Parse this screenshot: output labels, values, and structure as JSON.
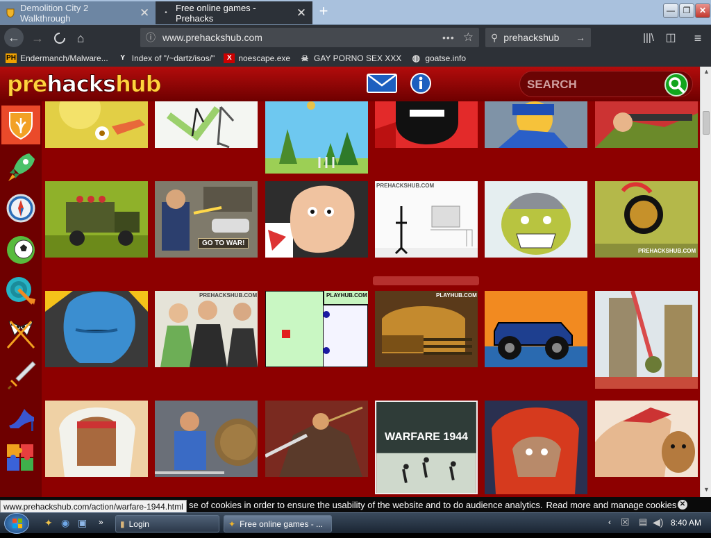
{
  "browser": {
    "tabs": [
      {
        "title": "Demolition City 2 Walkthrough",
        "active": false
      },
      {
        "title": "Free online games - Prehacks",
        "active": true
      }
    ],
    "url_display": "www.prehackshub.com",
    "search_value": "prehackshub",
    "bookmarks": [
      {
        "label": "Endermanch/Malware...",
        "icon": "PH"
      },
      {
        "label": "Index of \"/~dartz/isos/\"",
        "icon": "Y"
      },
      {
        "label": "noescape.exe",
        "icon": "X"
      },
      {
        "label": "GAY PORNO SEX XXX",
        "icon": "skull-icon"
      },
      {
        "label": "goatse.info",
        "icon": "globe-icon"
      }
    ]
  },
  "site": {
    "logo_part1": "pre",
    "logo_part2": "hacks",
    "logo_part3": "hub",
    "search_placeholder": "SEARCH",
    "categories": [
      "shield",
      "rocket",
      "compass",
      "soccer-ball",
      "target",
      "racing-flags",
      "sword",
      "high-heel",
      "puzzle"
    ],
    "hover_game_title": "WARFARE 1944",
    "watermarks": {
      "prehackshub": "PREHACKSHUB.COM",
      "playhub": "PLAYHUB.COM",
      "prehackshub_lower": "PREHACKSHUB.COM"
    },
    "go_to_war_label": "GO TO WAR!"
  },
  "cookie_bar": {
    "text": "se of cookies in order to ensure the usability of the website and to do audience analytics.",
    "link": "Read more and manage cookies"
  },
  "status_url": "www.prehackshub.com/action/warfare-1944.html",
  "taskbar": {
    "windows": [
      {
        "label": "Login"
      },
      {
        "label": "Free online games - ..."
      }
    ],
    "clock": "8:40 AM"
  }
}
